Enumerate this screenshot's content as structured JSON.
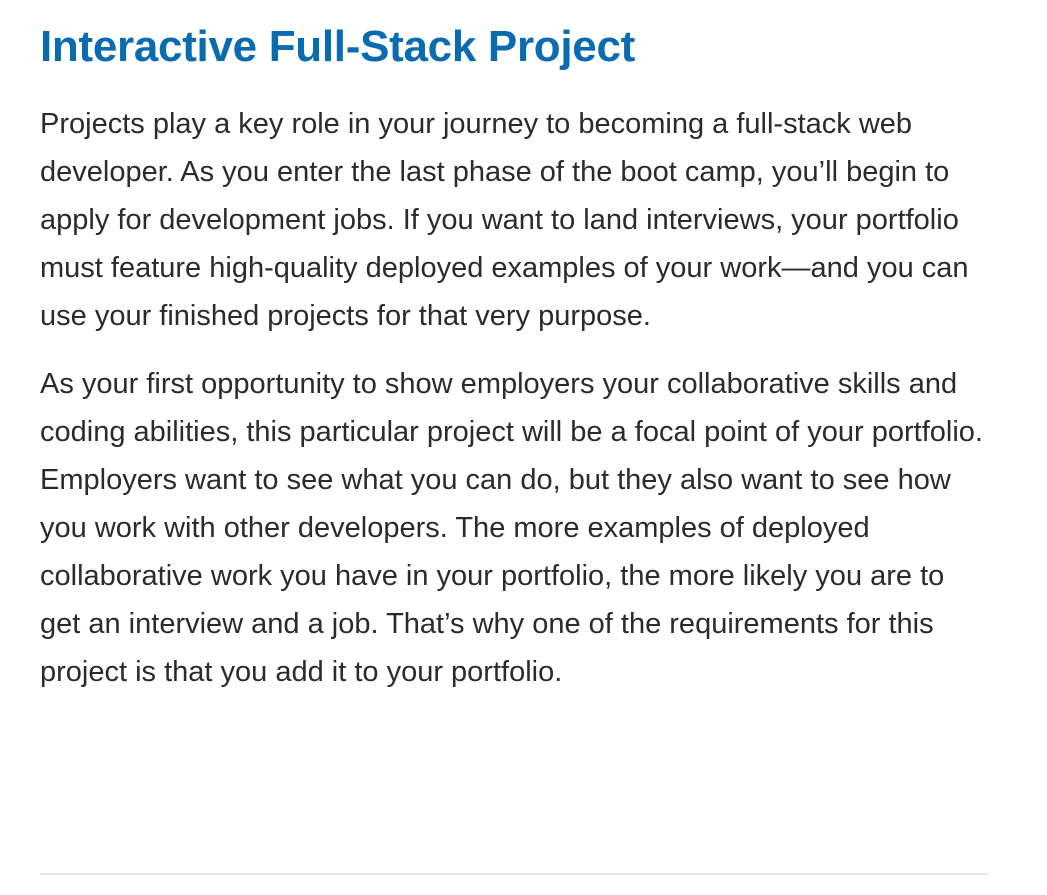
{
  "page": {
    "title": "Interactive Full-Stack Project",
    "paragraphs": [
      "Projects play a key role in your journey to becoming a full-stack web developer. As you enter the last phase of the boot camp, you’ll begin to apply for development jobs. If you want to land interviews, your portfolio must feature high-quality deployed examples of your work—and you can use your finished projects for that very purpose.",
      "As your first opportunity to show employers your collaborative skills and coding abilities, this particular project will be a focal point of your portfolio. Employers want to see what you can do, but they also want to see how you work with other developers. The more examples of deployed collaborative work you have in your portfolio, the more likely you are to get an interview and a job. That’s why one of the requirements for this project is that you add it to your portfolio."
    ]
  },
  "colors": {
    "title": "#0b6bb0",
    "body_text": "#2b2b2b",
    "divider": "#e6e6e6",
    "background": "#ffffff"
  }
}
